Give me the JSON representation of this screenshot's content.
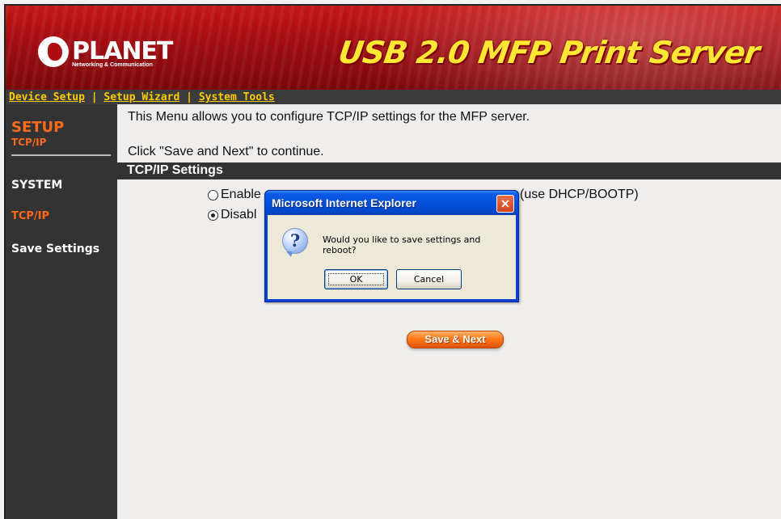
{
  "banner": {
    "logo_text": "PLANET",
    "logo_sub": "Networking & Communication",
    "product_title": "USB 2.0 MFP Print Server"
  },
  "topnav": {
    "items": [
      "Device Setup",
      "Setup Wizard",
      "System Tools"
    ],
    "separator": "|"
  },
  "sidebar": {
    "section_title": "SETUP",
    "section_sub": "TCP/IP",
    "items": [
      {
        "label": "SYSTEM",
        "color": "#ffffff"
      },
      {
        "label": "TCP/IP",
        "color": "#ff6a1a"
      },
      {
        "label": "Save Settings",
        "color": "#ffffff"
      }
    ]
  },
  "main": {
    "intro": "This Menu allows you to configure TCP/IP settings for the MFP server.",
    "instruction": "Click \"Save and Next\" to continue.",
    "section_title": "TCP/IP Settings",
    "options": [
      {
        "label": "Enable",
        "checked": false
      },
      {
        "label": "Disabl",
        "checked": true
      }
    ],
    "dhcp_text": "(use DHCP/BOOTP)",
    "save_next_label": "Save & Next"
  },
  "dialog": {
    "title": "Microsoft Internet Explorer",
    "close_glyph": "✕",
    "icon": "question-icon",
    "icon_glyph": "?",
    "message": "Would you like to save settings and reboot?",
    "ok_label": "OK",
    "cancel_label": "Cancel"
  },
  "colors": {
    "banner_red": "#b00d12",
    "nav_bg": "#333333",
    "nav_link": "#ffcc00",
    "accent_orange": "#ff6a1a",
    "dialog_blue": "#0550d8"
  }
}
